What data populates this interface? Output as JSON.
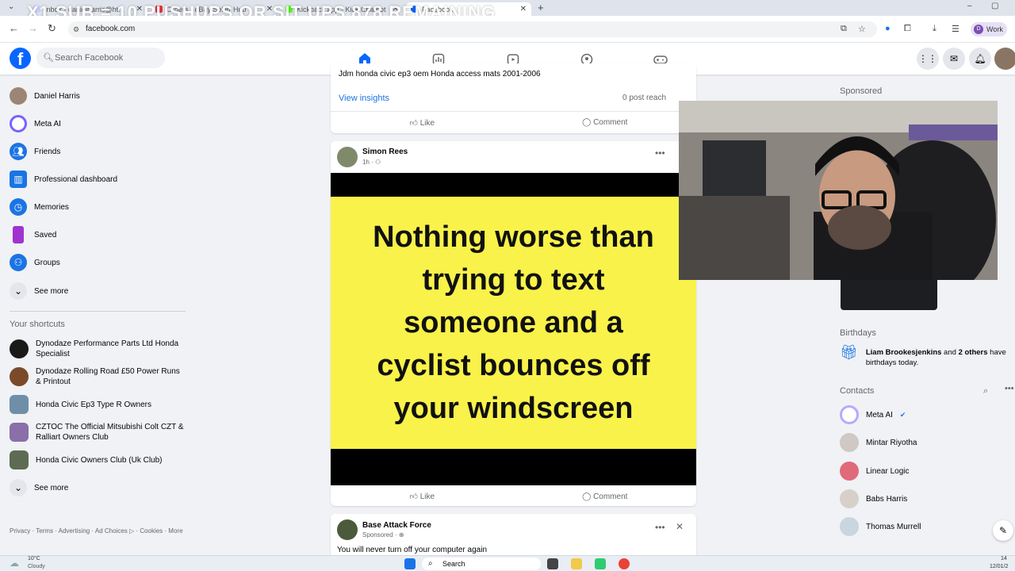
{
  "overlay_text": "X1 SUB = 10 PUSHUPS OR SIT UPS 878 REMAINING",
  "browser": {
    "tabs": [
      {
        "label": "Inbox - danielharris@ht...",
        "left": 0
      },
      {
        "label": "Orders - eBay Seller Hub"
      },
      {
        "label": "Kickback app - Kick Chatbot"
      },
      {
        "label": "Facebook"
      }
    ],
    "url": "facebook.com",
    "profile_label": "Work",
    "profile_initial": "D"
  },
  "fb": {
    "search_placeholder": "Search Facebook"
  },
  "sidebar": {
    "items": [
      {
        "label": "Daniel Harris"
      },
      {
        "label": "Meta AI"
      },
      {
        "label": "Friends"
      },
      {
        "label": "Professional dashboard"
      },
      {
        "label": "Memories"
      },
      {
        "label": "Saved"
      },
      {
        "label": "Groups"
      },
      {
        "label": "See more"
      }
    ],
    "shortcuts_heading": "Your shortcuts",
    "shortcuts": [
      {
        "label": "Dynodaze Performance Parts Ltd Honda Specialist"
      },
      {
        "label": "Dynodaze Rolling Road £50 Power Runs & Printout"
      },
      {
        "label": "Honda Civic Ep3 Type R Owners"
      },
      {
        "label": "CZTOC The Official Mitsubishi Colt CZT & Ralliart Owners Club"
      },
      {
        "label": "Honda Civic Owners Club (Uk Club)"
      }
    ],
    "shortcuts_see_more": "See more",
    "footer": "Privacy · Terms · Advertising · Ad Choices ▷ · Cookies · More"
  },
  "feed": {
    "prev_post_text": "Jdm honda civic ep3 oem Honda access mats 2001-2006",
    "view_insights": "View insights",
    "post_reach": "0 post reach",
    "like": "Like",
    "comment": "Comment",
    "post2": {
      "author": "Simon Rees",
      "time": "1h",
      "meme_text": "Nothing worse than\ntrying to text\nsomeone and a\ncyclist bounces off\nyour windscreen"
    },
    "post3": {
      "author": "Base Attack Force",
      "sponsored": "Sponsored",
      "text": "You will never turn off your computer again"
    }
  },
  "right": {
    "sponsored": "Sponsored",
    "birthdays_title": "Birthdays",
    "birthday_name": "Liam Brookesjenkins",
    "birthday_and": " and ",
    "birthday_others": "2 others",
    "birthday_rest": " have birthdays today.",
    "contacts_title": "Contacts",
    "contacts": [
      {
        "name": "Meta AI",
        "color": "#ffffff"
      },
      {
        "name": "Mintar Riyotha",
        "color": "#cfc8c4"
      },
      {
        "name": "Linear Logic",
        "color": "#e06a7a"
      },
      {
        "name": "Babs Harris",
        "color": "#d7d0c9"
      },
      {
        "name": "Thomas Murrell",
        "color": "#c9d6e0"
      }
    ]
  },
  "taskbar": {
    "weather_temp": "10°C",
    "weather_desc": "Cloudy",
    "search": "Search",
    "time": "14",
    "date": "12/01/2"
  },
  "colors": {
    "brand": "#0866ff",
    "meme_bg": "#f9f24a"
  }
}
